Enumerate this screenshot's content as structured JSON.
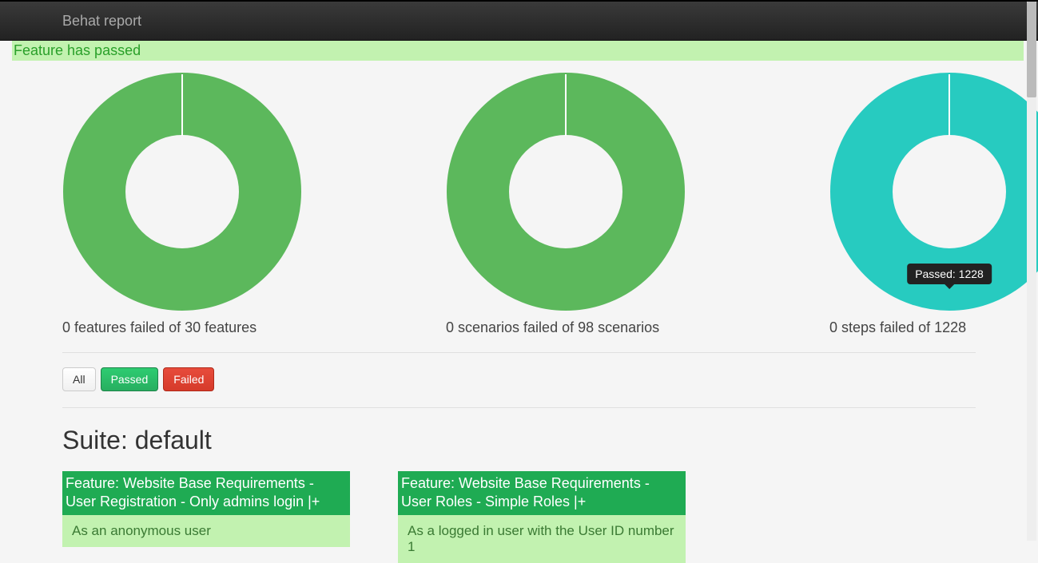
{
  "navbar": {
    "brand": "Behat report"
  },
  "alert": {
    "text": "Feature has passed"
  },
  "chart_data": [
    {
      "type": "pie",
      "title": "0 features failed of 30 features",
      "series": [
        {
          "name": "Passed",
          "value": 30,
          "color": "#5cb85c"
        },
        {
          "name": "Failed",
          "value": 0,
          "color": "#d9534f"
        }
      ]
    },
    {
      "type": "pie",
      "title": "0 scenarios failed of 98 scenarios",
      "series": [
        {
          "name": "Passed",
          "value": 98,
          "color": "#5cb85c"
        },
        {
          "name": "Failed",
          "value": 0,
          "color": "#d9534f"
        }
      ]
    },
    {
      "type": "pie",
      "title": "0 steps failed of 1228",
      "series": [
        {
          "name": "Passed",
          "value": 1228,
          "color": "#27cbc0"
        },
        {
          "name": "Failed",
          "value": 0,
          "color": "#d9534f"
        }
      ],
      "tooltip": "Passed: 1228"
    }
  ],
  "filters": {
    "all": "All",
    "passed": "Passed",
    "failed": "Failed"
  },
  "suite": {
    "prefix": "Suite: ",
    "name": "default"
  },
  "features": [
    {
      "title": "Feature: Website Base Requirements - User Registration - Only admins login |+",
      "body": "As an anonymous user"
    },
    {
      "title": "Feature: Website Base Requirements - User Roles - Simple Roles |+",
      "body": "As a logged in user with the User ID number 1"
    }
  ]
}
